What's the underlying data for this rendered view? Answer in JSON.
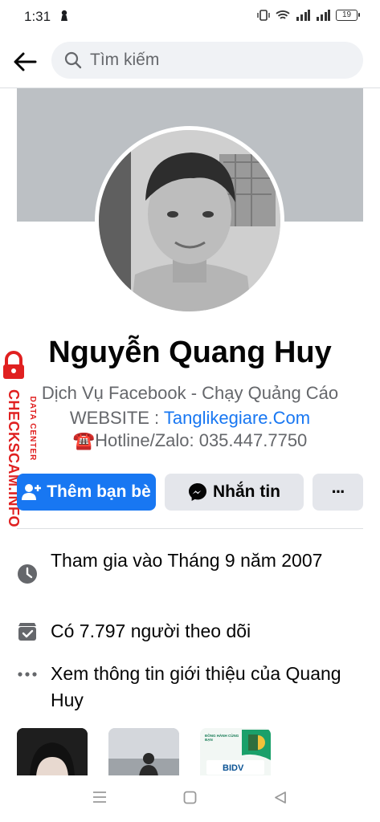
{
  "status_bar": {
    "time": "1:31",
    "battery": "19"
  },
  "search": {
    "placeholder": "Tìm kiếm"
  },
  "profile": {
    "name": "Nguyễn Quang Huy",
    "bio_line1": "Dịch Vụ Facebook - Chạy Quảng Cáo",
    "website_label": "WEBSITE : ",
    "website_link": "Tanglikegiare.Com",
    "hotline_icon": "☎️",
    "hotline": "Hotline/Zalo: 035.447.7750"
  },
  "actions": {
    "add_friend": "Thêm bạn bè",
    "message": "Nhắn tin",
    "more": "···"
  },
  "info": {
    "joined": "Tham gia vào Tháng 9 năm 2007",
    "followers": "Có 7.797 người theo dõi",
    "see_about": "Xem thông tin giới thiệu của Quang Huy"
  },
  "watermark": {
    "main": "CHECKSCAM.INFO",
    "sub": "DATA CENTER"
  },
  "photo3_text": {
    "top": "ĐỒNG HÀNH CÙNG BẠN",
    "brand": "BIDV"
  },
  "colors": {
    "accent": "#1877f2",
    "secondary_button": "#e4e6eb",
    "cover": "#bcc0c4",
    "watermark": "#e02020"
  },
  "icons": [
    "back-arrow-icon",
    "search-icon",
    "add-person-icon",
    "messenger-icon",
    "clock-icon",
    "followers-icon",
    "ellipsis-icon"
  ]
}
